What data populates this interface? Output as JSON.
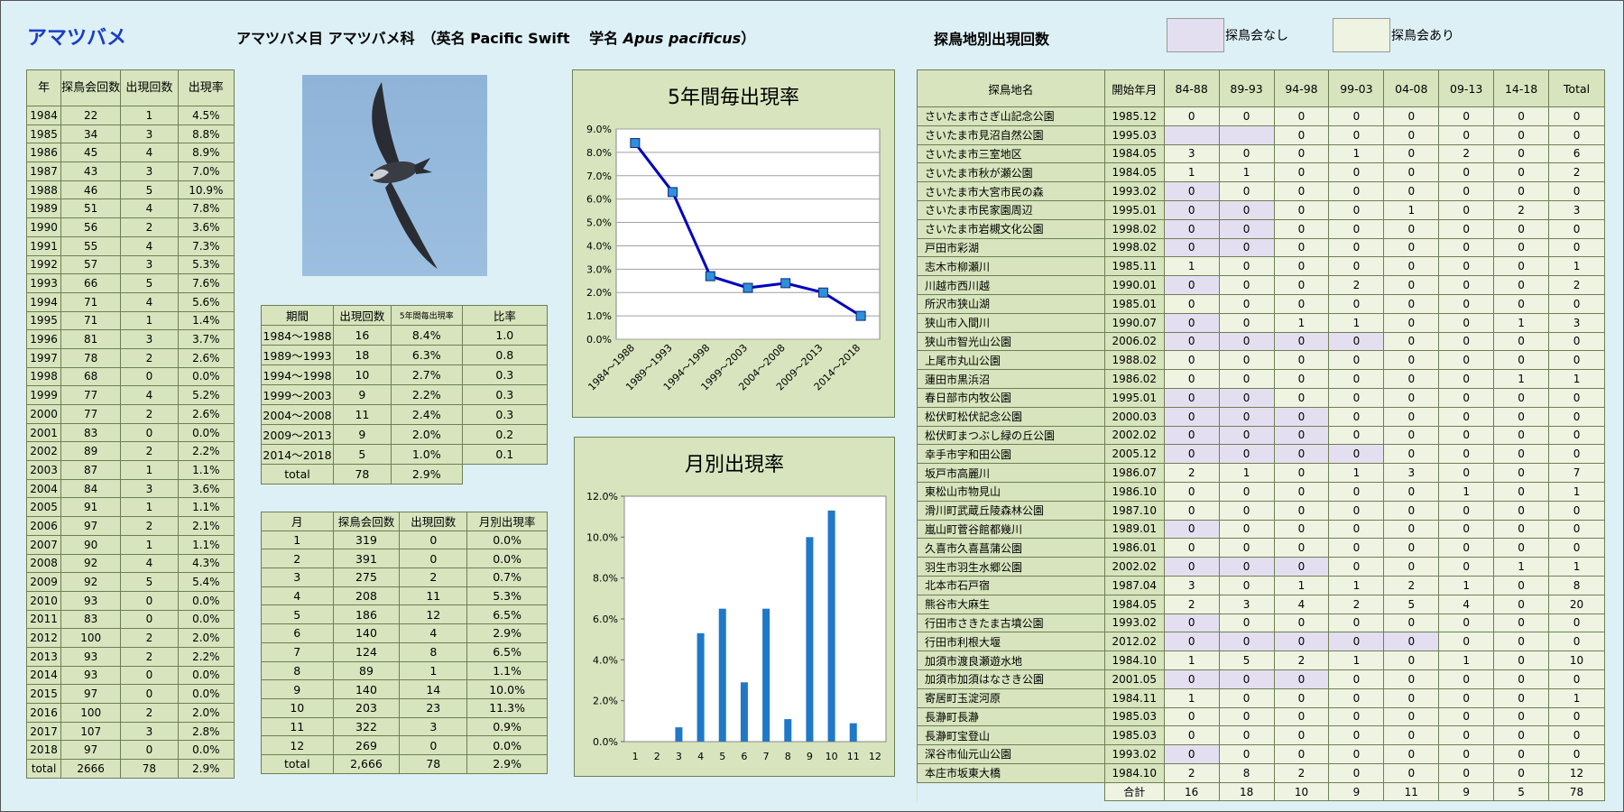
{
  "header": {
    "species": "アマツバメ",
    "taxonomy": "アマツバメ目 アマツバメ科　（英名 Pacific Swift　 学名 ",
    "sci_name": "Apus pacificus",
    "closing": "）",
    "site_title": "探鳥地別出現回数",
    "legend_none": "探鳥会なし",
    "legend_has": "探鳥会あり",
    "color_none": "#e4dff0",
    "color_has": "#eef3e2"
  },
  "year_table": {
    "headers": [
      "年",
      "探鳥会回数",
      "出現回数",
      "出現率"
    ],
    "rows": [
      [
        "1984",
        "22",
        "1",
        "4.5%"
      ],
      [
        "1985",
        "34",
        "3",
        "8.8%"
      ],
      [
        "1986",
        "45",
        "4",
        "8.9%"
      ],
      [
        "1987",
        "43",
        "3",
        "7.0%"
      ],
      [
        "1988",
        "46",
        "5",
        "10.9%"
      ],
      [
        "1989",
        "51",
        "4",
        "7.8%"
      ],
      [
        "1990",
        "56",
        "2",
        "3.6%"
      ],
      [
        "1991",
        "55",
        "4",
        "7.3%"
      ],
      [
        "1992",
        "57",
        "3",
        "5.3%"
      ],
      [
        "1993",
        "66",
        "5",
        "7.6%"
      ],
      [
        "1994",
        "71",
        "4",
        "5.6%"
      ],
      [
        "1995",
        "71",
        "1",
        "1.4%"
      ],
      [
        "1996",
        "81",
        "3",
        "3.7%"
      ],
      [
        "1997",
        "78",
        "2",
        "2.6%"
      ],
      [
        "1998",
        "68",
        "0",
        "0.0%"
      ],
      [
        "1999",
        "77",
        "4",
        "5.2%"
      ],
      [
        "2000",
        "77",
        "2",
        "2.6%"
      ],
      [
        "2001",
        "83",
        "0",
        "0.0%"
      ],
      [
        "2002",
        "89",
        "2",
        "2.2%"
      ],
      [
        "2003",
        "87",
        "1",
        "1.1%"
      ],
      [
        "2004",
        "84",
        "3",
        "3.6%"
      ],
      [
        "2005",
        "91",
        "1",
        "1.1%"
      ],
      [
        "2006",
        "97",
        "2",
        "2.1%"
      ],
      [
        "2007",
        "90",
        "1",
        "1.1%"
      ],
      [
        "2008",
        "92",
        "4",
        "4.3%"
      ],
      [
        "2009",
        "92",
        "5",
        "5.4%"
      ],
      [
        "2010",
        "93",
        "0",
        "0.0%"
      ],
      [
        "2011",
        "83",
        "0",
        "0.0%"
      ],
      [
        "2012",
        "100",
        "2",
        "2.0%"
      ],
      [
        "2013",
        "93",
        "2",
        "2.2%"
      ],
      [
        "2014",
        "93",
        "0",
        "0.0%"
      ],
      [
        "2015",
        "97",
        "0",
        "0.0%"
      ],
      [
        "2016",
        "100",
        "2",
        "2.0%"
      ],
      [
        "2017",
        "107",
        "3",
        "2.8%"
      ],
      [
        "2018",
        "97",
        "0",
        "0.0%"
      ],
      [
        "total",
        "2666",
        "78",
        "2.9%"
      ]
    ]
  },
  "period_table": {
    "headers": [
      "期間",
      "出現回数",
      "5年間毎出現率",
      "比率"
    ],
    "rows": [
      [
        "1984～1988",
        "16",
        "8.4%",
        "1.0"
      ],
      [
        "1989～1993",
        "18",
        "6.3%",
        "0.8"
      ],
      [
        "1994～1998",
        "10",
        "2.7%",
        "0.3"
      ],
      [
        "1999～2003",
        "9",
        "2.2%",
        "0.3"
      ],
      [
        "2004～2008",
        "11",
        "2.4%",
        "0.3"
      ],
      [
        "2009～2013",
        "9",
        "2.0%",
        "0.2"
      ],
      [
        "2014～2018",
        "5",
        "1.0%",
        "0.1"
      ]
    ],
    "total": [
      "total",
      "78",
      "2.9%"
    ]
  },
  "month_table": {
    "headers": [
      "月",
      "探鳥会回数",
      "出現回数",
      "月別出現率"
    ],
    "rows": [
      [
        "1",
        "319",
        "0",
        "0.0%"
      ],
      [
        "2",
        "391",
        "0",
        "0.0%"
      ],
      [
        "3",
        "275",
        "2",
        "0.7%"
      ],
      [
        "4",
        "208",
        "11",
        "5.3%"
      ],
      [
        "5",
        "186",
        "12",
        "6.5%"
      ],
      [
        "6",
        "140",
        "4",
        "2.9%"
      ],
      [
        "7",
        "124",
        "8",
        "6.5%"
      ],
      [
        "8",
        "89",
        "1",
        "1.1%"
      ],
      [
        "9",
        "140",
        "14",
        "10.0%"
      ],
      [
        "10",
        "203",
        "23",
        "11.3%"
      ],
      [
        "11",
        "322",
        "3",
        "0.9%"
      ],
      [
        "12",
        "269",
        "0",
        "0.0%"
      ],
      [
        "total",
        "2,666",
        "78",
        "2.9%"
      ]
    ]
  },
  "site_table": {
    "headers": [
      "探鳥地名",
      "開始年月",
      "84-88",
      "89-93",
      "94-98",
      "99-03",
      "04-08",
      "09-13",
      "14-18",
      "Total"
    ],
    "rows": [
      {
        "name": "さいたま市さぎ山記念公園",
        "start": "1985.12",
        "v": [
          "0",
          "0",
          "0",
          "0",
          "0",
          "0",
          "0",
          "0"
        ],
        "n": []
      },
      {
        "name": "さいたま市見沼自然公園",
        "start": "1995.03",
        "v": [
          "",
          "",
          "0",
          "0",
          "0",
          "0",
          "0",
          "0"
        ],
        "n": [
          0,
          1
        ]
      },
      {
        "name": "さいたま市三室地区",
        "start": "1984.05",
        "v": [
          "3",
          "0",
          "0",
          "1",
          "0",
          "2",
          "0",
          "6"
        ],
        "n": []
      },
      {
        "name": "さいたま市秋が瀬公園",
        "start": "1984.05",
        "v": [
          "1",
          "1",
          "0",
          "0",
          "0",
          "0",
          "0",
          "2"
        ],
        "n": []
      },
      {
        "name": "さいたま市大宮市民の森",
        "start": "1993.02",
        "v": [
          "0",
          "0",
          "0",
          "0",
          "0",
          "0",
          "0",
          "0"
        ],
        "n": [
          0
        ]
      },
      {
        "name": "さいたま市民家園周辺",
        "start": "1995.01",
        "v": [
          "0",
          "0",
          "0",
          "0",
          "1",
          "0",
          "2",
          "3"
        ],
        "n": [
          0,
          1
        ]
      },
      {
        "name": "さいたま市岩槻文化公園",
        "start": "1998.02",
        "v": [
          "0",
          "0",
          "0",
          "0",
          "0",
          "0",
          "0",
          "0"
        ],
        "n": [
          0,
          1
        ]
      },
      {
        "name": "戸田市彩湖",
        "start": "1998.02",
        "v": [
          "0",
          "0",
          "0",
          "0",
          "0",
          "0",
          "0",
          "0"
        ],
        "n": [
          0,
          1
        ]
      },
      {
        "name": "志木市柳瀬川",
        "start": "1985.11",
        "v": [
          "1",
          "0",
          "0",
          "0",
          "0",
          "0",
          "0",
          "1"
        ],
        "n": []
      },
      {
        "name": "川越市西川越",
        "start": "1990.01",
        "v": [
          "0",
          "0",
          "0",
          "2",
          "0",
          "0",
          "0",
          "2"
        ],
        "n": [
          0
        ]
      },
      {
        "name": "所沢市狭山湖",
        "start": "1985.01",
        "v": [
          "0",
          "0",
          "0",
          "0",
          "0",
          "0",
          "0",
          "0"
        ],
        "n": []
      },
      {
        "name": "狭山市入間川",
        "start": "1990.07",
        "v": [
          "0",
          "0",
          "1",
          "1",
          "0",
          "0",
          "1",
          "3"
        ],
        "n": [
          0
        ]
      },
      {
        "name": "狭山市智光山公園",
        "start": "2006.02",
        "v": [
          "0",
          "0",
          "0",
          "0",
          "0",
          "0",
          "0",
          "0"
        ],
        "n": [
          0,
          1,
          2,
          3
        ]
      },
      {
        "name": "上尾市丸山公園",
        "start": "1988.02",
        "v": [
          "0",
          "0",
          "0",
          "0",
          "0",
          "0",
          "0",
          "0"
        ],
        "n": []
      },
      {
        "name": "蓮田市黒浜沼",
        "start": "1986.02",
        "v": [
          "0",
          "0",
          "0",
          "0",
          "0",
          "0",
          "1",
          "1"
        ],
        "n": []
      },
      {
        "name": "春日部市内牧公園",
        "start": "1995.01",
        "v": [
          "0",
          "0",
          "0",
          "0",
          "0",
          "0",
          "0",
          "0"
        ],
        "n": [
          0,
          1
        ]
      },
      {
        "name": "松伏町松伏記念公園",
        "start": "2000.03",
        "v": [
          "0",
          "0",
          "0",
          "0",
          "0",
          "0",
          "0",
          "0"
        ],
        "n": [
          0,
          1,
          2
        ]
      },
      {
        "name": "松伏町まつぶし緑の丘公園",
        "start": "2002.02",
        "v": [
          "0",
          "0",
          "0",
          "0",
          "0",
          "0",
          "0",
          "0"
        ],
        "n": [
          0,
          1,
          2
        ]
      },
      {
        "name": "幸手市宇和田公園",
        "start": "2005.12",
        "v": [
          "0",
          "0",
          "0",
          "0",
          "0",
          "0",
          "0",
          "0"
        ],
        "n": [
          0,
          1,
          2,
          3
        ]
      },
      {
        "name": "坂戸市高麗川",
        "start": "1986.07",
        "v": [
          "2",
          "1",
          "0",
          "1",
          "3",
          "0",
          "0",
          "7"
        ],
        "n": []
      },
      {
        "name": "東松山市物見山",
        "start": "1986.10",
        "v": [
          "0",
          "0",
          "0",
          "0",
          "0",
          "1",
          "0",
          "1"
        ],
        "n": []
      },
      {
        "name": "滑川町武蔵丘陵森林公園",
        "start": "1987.10",
        "v": [
          "0",
          "0",
          "0",
          "0",
          "0",
          "0",
          "0",
          "0"
        ],
        "n": []
      },
      {
        "name": "嵐山町菅谷館都幾川",
        "start": "1989.01",
        "v": [
          "0",
          "0",
          "0",
          "0",
          "0",
          "0",
          "0",
          "0"
        ],
        "n": [
          0
        ]
      },
      {
        "name": "久喜市久喜菖蒲公園",
        "start": "1986.01",
        "v": [
          "0",
          "0",
          "0",
          "0",
          "0",
          "0",
          "0",
          "0"
        ],
        "n": []
      },
      {
        "name": "羽生市羽生水郷公園",
        "start": "2002.02",
        "v": [
          "0",
          "0",
          "0",
          "0",
          "0",
          "0",
          "1",
          "1"
        ],
        "n": [
          0,
          1,
          2
        ]
      },
      {
        "name": "北本市石戸宿",
        "start": "1987.04",
        "v": [
          "3",
          "0",
          "1",
          "1",
          "2",
          "1",
          "0",
          "8"
        ],
        "n": []
      },
      {
        "name": "熊谷市大麻生",
        "start": "1984.05",
        "v": [
          "2",
          "3",
          "4",
          "2",
          "5",
          "4",
          "0",
          "20"
        ],
        "n": []
      },
      {
        "name": "行田市さきたま古墳公園",
        "start": "1993.02",
        "v": [
          "0",
          "0",
          "0",
          "0",
          "0",
          "0",
          "0",
          "0"
        ],
        "n": [
          0
        ]
      },
      {
        "name": "行田市利根大堰",
        "start": "2012.02",
        "v": [
          "0",
          "0",
          "0",
          "0",
          "0",
          "0",
          "0",
          "0"
        ],
        "n": [
          0,
          1,
          2,
          3,
          4
        ]
      },
      {
        "name": "加須市渡良瀬遊水地",
        "start": "1984.10",
        "v": [
          "1",
          "5",
          "2",
          "1",
          "0",
          "1",
          "0",
          "10"
        ],
        "n": []
      },
      {
        "name": "加須市加須はなさき公園",
        "start": "2001.05",
        "v": [
          "0",
          "0",
          "0",
          "0",
          "0",
          "0",
          "0",
          "0"
        ],
        "n": [
          0,
          1,
          2
        ]
      },
      {
        "name": "寄居町玉淀河原",
        "start": "1984.11",
        "v": [
          "1",
          "0",
          "0",
          "0",
          "0",
          "0",
          "0",
          "1"
        ],
        "n": []
      },
      {
        "name": "長瀞町長瀞",
        "start": "1985.03",
        "v": [
          "0",
          "0",
          "0",
          "0",
          "0",
          "0",
          "0",
          "0"
        ],
        "n": []
      },
      {
        "name": "長瀞町宝登山",
        "start": "1985.03",
        "v": [
          "0",
          "0",
          "0",
          "0",
          "0",
          "0",
          "0",
          "0"
        ],
        "n": []
      },
      {
        "name": "深谷市仙元山公園",
        "start": "1993.02",
        "v": [
          "0",
          "0",
          "0",
          "0",
          "0",
          "0",
          "0",
          "0"
        ],
        "n": [
          0
        ]
      },
      {
        "name": "本庄市坂東大橋",
        "start": "1984.10",
        "v": [
          "2",
          "8",
          "2",
          "0",
          "0",
          "0",
          "0",
          "12"
        ],
        "n": []
      }
    ],
    "sum_label": "合計",
    "sums": [
      "16",
      "18",
      "10",
      "9",
      "11",
      "9",
      "5",
      "78"
    ]
  },
  "chart_data": [
    {
      "type": "line",
      "title": "5年間毎出現率",
      "categories": [
        "1984～1988",
        "1989～1993",
        "1994～1998",
        "1999～2003",
        "2004～2008",
        "2009～2013",
        "2014～2018"
      ],
      "values": [
        8.4,
        6.3,
        2.7,
        2.2,
        2.4,
        2.0,
        1.0
      ],
      "ylim": [
        0,
        9
      ],
      "yticks": [
        "0.0%",
        "1.0%",
        "2.0%",
        "3.0%",
        "4.0%",
        "5.0%",
        "6.0%",
        "7.0%",
        "8.0%",
        "9.0%"
      ],
      "grid": true,
      "color": "#0000c0",
      "marker_color": "#2f8fd8"
    },
    {
      "type": "bar",
      "title": "月別出現率",
      "categories": [
        "1",
        "2",
        "3",
        "4",
        "5",
        "6",
        "7",
        "8",
        "9",
        "10",
        "11",
        "12"
      ],
      "values": [
        0.0,
        0.0,
        0.7,
        5.3,
        6.5,
        2.9,
        6.5,
        1.1,
        10.0,
        11.3,
        0.9,
        0.0
      ],
      "ylim": [
        0,
        12
      ],
      "yticks": [
        "0.0%",
        "2.0%",
        "4.0%",
        "6.0%",
        "8.0%",
        "10.0%",
        "12.0%"
      ],
      "grid": false,
      "color": "#1f78c8"
    }
  ]
}
